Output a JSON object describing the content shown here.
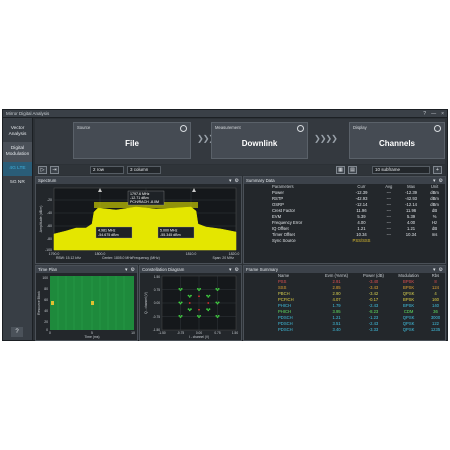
{
  "window": {
    "title": "Mirror Digital Analysis",
    "help": "?",
    "minimize": "—",
    "close": "×"
  },
  "sidebar": {
    "items": [
      {
        "label": "Vector Analysis"
      },
      {
        "label": "Digital Modulation"
      },
      {
        "label": "4G LTE"
      },
      {
        "label": "5G NR"
      }
    ],
    "help": "?"
  },
  "flow": {
    "source": {
      "label": "Source",
      "value": "File"
    },
    "measurement": {
      "label": "Measurement",
      "value": "Downlink"
    },
    "display": {
      "label": "Display",
      "value": "Channels"
    },
    "arrows": "❯❯❯❯"
  },
  "toolbar": {
    "rows": "2 row",
    "cols": "3 column",
    "subframe": "10 subframe"
  },
  "spectrum": {
    "title": "Spectrum",
    "ylabel": "Amplitude (dBm)",
    "xlabel": "Frequency (MHz)",
    "rbw": "RBW: 15.12 kHz",
    "center": "Center: 1805.0 MHz",
    "span": "Span: 20 MHz",
    "yticks": [
      "-20",
      "-40",
      "-60",
      "-80",
      "-100"
    ],
    "xticks": [
      "1790.0",
      "1800.0",
      "1810.0",
      "1820.0"
    ],
    "marker_box": [
      "1797.6 MHz",
      "-12.71 dBm",
      "PCH/RACH -8.0M"
    ],
    "delta_left": [
      "4.981 MHz",
      "-54.675 dBm"
    ],
    "delta_right": [
      "5.000 MHz",
      "-55.345 dBm"
    ]
  },
  "summary": {
    "title": "Summary Data",
    "headers": [
      "Parameters",
      "Curr",
      "Avg",
      "Max",
      "Unit"
    ],
    "rows": [
      [
        "Power",
        "-12.39",
        "---",
        "-12.39",
        "dBm"
      ],
      [
        "RSTP",
        "-42.93",
        "---",
        "-42.93",
        "dBm"
      ],
      [
        "OSRP",
        "-12.14",
        "---",
        "-12.14",
        "dBm"
      ],
      [
        "Crest Factor",
        "11.96",
        "---",
        "11.96",
        "dB"
      ],
      [
        "EVM",
        "5.39",
        "---",
        "5.39",
        "%"
      ],
      [
        "Frequency Error",
        "4.00",
        "---",
        "4.00",
        "Hz"
      ],
      [
        "IQ Offset",
        "1.21",
        "---",
        "1.21",
        "dB"
      ],
      [
        "Timer Offset",
        "10.34",
        "---",
        "10.34",
        "ms"
      ],
      [
        "Sync Source",
        "PSS/SSS",
        "",
        "",
        ""
      ]
    ]
  },
  "timeplan": {
    "title": "Time Plan",
    "ylabel": "Resource Block",
    "xlabel": "Time (ms)",
    "yticks": [
      "100",
      "80",
      "60",
      "40",
      "20",
      "0"
    ],
    "xticks": [
      "0",
      "5",
      "10"
    ]
  },
  "constellation": {
    "title": "Constellation Diagram",
    "ylabel": "Q - channel (V)",
    "xlabel": "I - channel (V)",
    "ticks": [
      "-1.50",
      "-0.75",
      "0.00",
      "0.75",
      "1.50"
    ]
  },
  "frame": {
    "title": "Frame Summary",
    "headers": [
      "Name",
      "Evm (%rms)",
      "Power (dB)",
      "Modulation",
      "Rbs"
    ],
    "rows": [
      [
        "PSS",
        "2.91",
        "-3.40",
        "BPSK",
        "8"
      ],
      [
        "SSS",
        "2.85",
        "-3.43",
        "BPSK",
        "124"
      ],
      [
        "PBCH",
        "2.90",
        "-3.42",
        "QPSK",
        "4"
      ],
      [
        "PCFICH",
        "4.07",
        "-0.17",
        "BPSK",
        "160"
      ],
      [
        "PHICH",
        "1.79",
        "-2.43",
        "BPSK",
        "140"
      ],
      [
        "PHICH",
        "3.95",
        "-8.23",
        "CDM",
        "36"
      ],
      [
        "PDSCH",
        "1.21",
        "-1.23",
        "QPSK",
        "3000"
      ],
      [
        "PDSCH",
        "3.51",
        "-2.43",
        "QPSK",
        "122"
      ],
      [
        "PDSCH",
        "3.40",
        "-3.33",
        "QPSK",
        "1235"
      ]
    ],
    "row_colors": [
      "#e05050",
      "#e0a030",
      "#d8d050",
      "#e0d040",
      "#40c0e0",
      "#60e060",
      "#40c0e0",
      "#40c0e0",
      "#40c0e0"
    ]
  },
  "colors": {
    "spectrum_trace": "#e4e600",
    "timeplan_bg": "#1e8a3c",
    "accent": "#3fb4e0",
    "constellation_points": "#40d040"
  }
}
